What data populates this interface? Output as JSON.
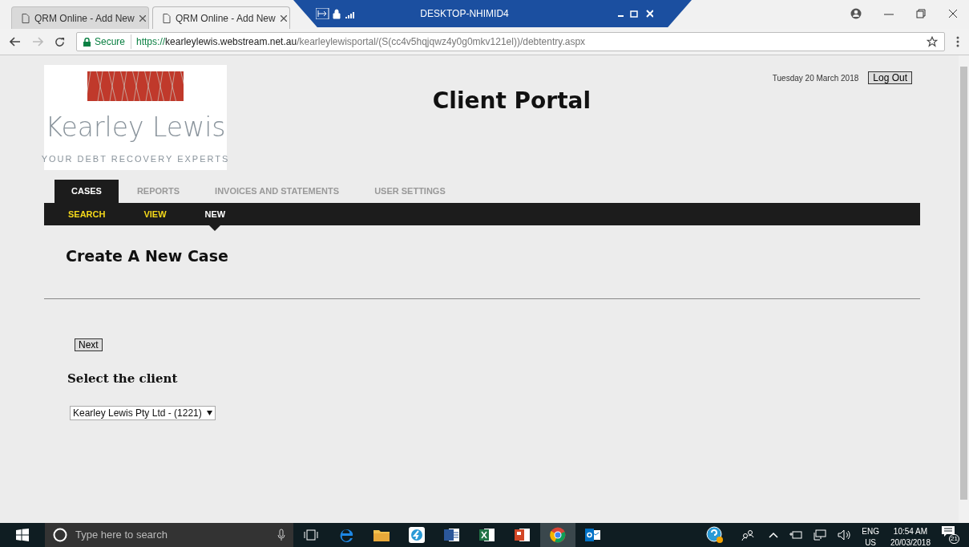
{
  "browser_tabs": [
    {
      "title": "QRM Online - Add New",
      "selected": false
    },
    {
      "title": "QRM Online - Add New",
      "selected": true
    }
  ],
  "remote_bar": {
    "title": "DESKTOP-NHIMID4"
  },
  "address_bar": {
    "secure_label": "Secure",
    "url_scheme": "https://",
    "url_host": "kearleylewis.webstream.net.au",
    "url_path": "/kearleylewisportal/(S(cc4v5hqjqwz4y0g0mkv121el))/debtentry.aspx"
  },
  "page": {
    "logo": {
      "name": "Kearley Lewis",
      "tagline": "YOUR DEBT RECOVERY EXPERTS"
    },
    "title": "Client Portal",
    "date": "Tuesday 20 March 2018",
    "logout": "Log Out",
    "nav_tabs": [
      {
        "label": "CASES",
        "selected": true
      },
      {
        "label": "REPORTS",
        "selected": false
      },
      {
        "label": "INVOICES AND STATEMENTS",
        "selected": false
      },
      {
        "label": "USER SETTINGS",
        "selected": false
      }
    ],
    "sub_nav": [
      {
        "label": "SEARCH",
        "selected": false
      },
      {
        "label": "VIEW",
        "selected": false
      },
      {
        "label": "NEW",
        "selected": true
      }
    ],
    "heading": "Create A New Case",
    "next_button": "Next",
    "client_label": "Select the client",
    "client_select": "Kearley Lewis Pty Ltd - (1221)"
  },
  "taskbar": {
    "search_placeholder": "Type here to search",
    "language": "ENG",
    "region": "US",
    "time": "10:54 AM",
    "date": "20/03/2018",
    "notification_count": "21"
  }
}
